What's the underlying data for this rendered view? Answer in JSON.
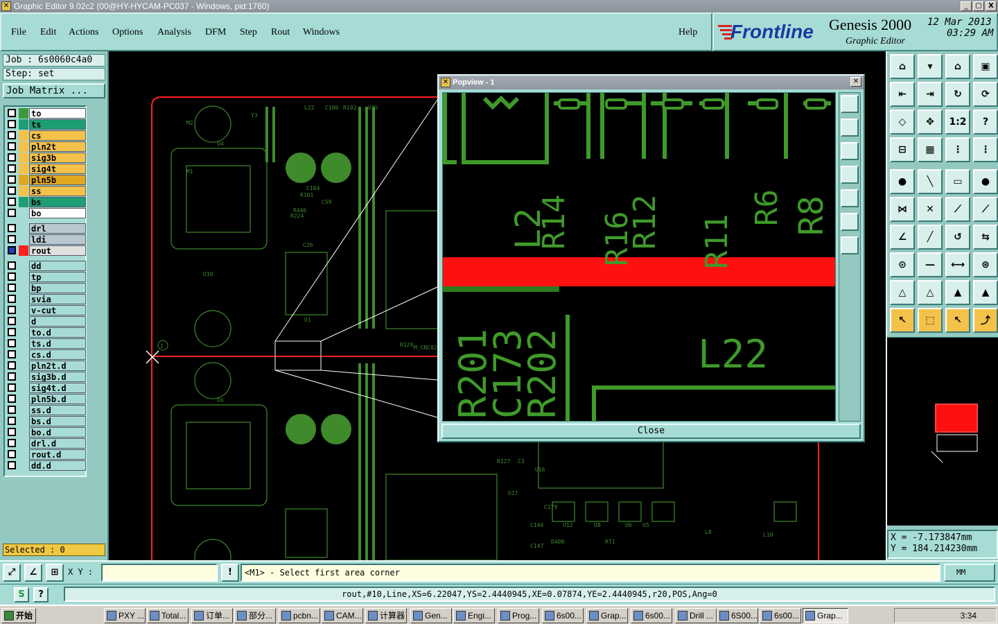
{
  "window": {
    "title": "Graphic Editor 9.02c2 (00@HY-HYCAM-PC037 - Windows, pid:1760)",
    "controls": [
      "_",
      "▢",
      "X"
    ]
  },
  "menubar": {
    "items": [
      "File",
      "Edit",
      "Actions",
      "Options",
      "Analysis",
      "DFM",
      "Step",
      "Rout",
      "Windows"
    ],
    "help": "Help"
  },
  "brand": {
    "logo_text": "Frontline",
    "product": "Genesis 2000",
    "subtitle": "Graphic Editor",
    "date": "12 Mar 2013",
    "time": "03:29 AM"
  },
  "left_panel": {
    "job": "Job : 6s0060c4a0",
    "step": "Step: set",
    "job_matrix": "Job Matrix ...",
    "layers": [
      {
        "name": "to",
        "color": "#ffffff",
        "swatch": "#3a9a3a"
      },
      {
        "name": "ts",
        "color": "#1e9e74",
        "swatch": "#1e9e74"
      },
      {
        "name": "cs",
        "color": "#f4c24a",
        "swatch": "#f4c24a"
      },
      {
        "name": "pln2t",
        "color": "#f4c24a",
        "swatch": "#f4c24a"
      },
      {
        "name": "sig3b",
        "color": "#f4c24a",
        "swatch": "#f4c24a"
      },
      {
        "name": "sig4t",
        "color": "#f4c24a",
        "swatch": "#f4c24a"
      },
      {
        "name": "pln5b",
        "color": "#e0a820",
        "swatch": "#e0a820"
      },
      {
        "name": "ss",
        "color": "#f4c24a",
        "swatch": "#f4c24a"
      },
      {
        "name": "bs",
        "color": "#1e9e74",
        "swatch": "#1e9e74"
      },
      {
        "name": "bo",
        "color": "#ffffff",
        "swatch": "#a7dcd6"
      },
      {
        "name": "drl",
        "color": "#b8c8d0",
        "swatch": "#a7dcd6"
      },
      {
        "name": "ldi",
        "color": "#b8c8d0",
        "swatch": "#a7dcd6"
      },
      {
        "name": "rout",
        "color": "#e0e0e0",
        "swatch": "#ff2020",
        "active": true
      },
      {
        "name": "dd",
        "color": "#a7dcd6",
        "swatch": "#a7dcd6"
      },
      {
        "name": "tp",
        "color": "#a7dcd6",
        "swatch": "#a7dcd6"
      },
      {
        "name": "bp",
        "color": "#a7dcd6",
        "swatch": "#a7dcd6"
      },
      {
        "name": "svia",
        "color": "#a7dcd6",
        "swatch": "#a7dcd6"
      },
      {
        "name": "v-cut",
        "color": "#a7dcd6",
        "swatch": "#a7dcd6"
      },
      {
        "name": "d",
        "color": "#a7dcd6",
        "swatch": "#a7dcd6"
      },
      {
        "name": "to.d",
        "color": "#a7dcd6",
        "swatch": "#a7dcd6"
      },
      {
        "name": "ts.d",
        "color": "#a7dcd6",
        "swatch": "#a7dcd6"
      },
      {
        "name": "cs.d",
        "color": "#a7dcd6",
        "swatch": "#a7dcd6"
      },
      {
        "name": "pln2t.d",
        "color": "#a7dcd6",
        "swatch": "#a7dcd6"
      },
      {
        "name": "sig3b.d",
        "color": "#a7dcd6",
        "swatch": "#a7dcd6"
      },
      {
        "name": "sig4t.d",
        "color": "#a7dcd6",
        "swatch": "#a7dcd6"
      },
      {
        "name": "pln5b.d",
        "color": "#a7dcd6",
        "swatch": "#a7dcd6"
      },
      {
        "name": "ss.d",
        "color": "#a7dcd6",
        "swatch": "#a7dcd6"
      },
      {
        "name": "bs.d",
        "color": "#a7dcd6",
        "swatch": "#a7dcd6"
      },
      {
        "name": "bo.d",
        "color": "#a7dcd6",
        "swatch": "#a7dcd6"
      },
      {
        "name": "drl.d",
        "color": "#a7dcd6",
        "swatch": "#a7dcd6"
      },
      {
        "name": "rout.d",
        "color": "#a7dcd6",
        "swatch": "#a7dcd6"
      },
      {
        "name": "dd.d",
        "color": "#a7dcd6",
        "swatch": "#a7dcd6"
      }
    ],
    "selected": "Selected : 0"
  },
  "popview": {
    "title": "Popview - 1",
    "close_label": "Close",
    "labels": [
      "L2",
      "R14",
      "R16",
      "R12",
      "R11",
      "R6",
      "R8",
      "R201",
      "C173",
      "R202",
      "L22"
    ]
  },
  "pcb": {
    "labels": [
      "L22",
      "U15",
      "R192",
      "C180",
      "Y3",
      "U4",
      "M2",
      "M1",
      "C184",
      "C59",
      "R101",
      "R446",
      "R224",
      "U16",
      "U1",
      "C26",
      "U4",
      "M_CNC02",
      "1",
      "U16",
      "U17",
      "U12",
      "U8",
      "U6",
      "U5",
      "D400",
      "C179",
      "C144",
      "C147",
      "RT1",
      "L8",
      "L10",
      "R129",
      "R127",
      "C3"
    ]
  },
  "right_panel": {
    "coord_x": "X = -7.173847mm",
    "coord_y": "Y = 184.214230mm",
    "tool_icons": [
      "home-icon",
      "zoom-window-icon",
      "zoom-home-icon",
      "grid-icon",
      "zoom-in-icon",
      "zoom-out-icon",
      "redraw-icon",
      "step-icon",
      "fit-icon",
      "pan-icon",
      "ratio-1-2-icon",
      "help-icon",
      "ruler-icon",
      "grid-toggle-icon",
      "snap-icon",
      "snap-alt-icon",
      "pad-icon",
      "line-icon",
      "measure-icon",
      "circle-icon",
      "node-icon",
      "cross-icon",
      "connect-icon",
      "connect-alt-icon",
      "angle-icon",
      "slope-icon",
      "arc-icon",
      "flip-icon",
      "pad-select-icon",
      "minus-icon",
      "dimension-icon",
      "group-icon",
      "triangle-icon",
      "triangle-alt-icon",
      "triangle-pick-icon",
      "triangle-edit-icon",
      "pointer-icon",
      "pointer-box-icon",
      "pointer-alt-icon",
      "path-icon"
    ]
  },
  "command": {
    "xy_label": "X Y :",
    "xy_value": "",
    "info_icon": "!",
    "prompt": "<M1> - Select first area corner",
    "units": "MM"
  },
  "status": {
    "text": "rout,#10,Line,XS=6.22047,YS=2.4440945,XE=0.07874,YE=2.4440945,r20,POS,Ang=0"
  },
  "taskbar": {
    "start": "开始",
    "tasks": [
      "PXY ...",
      "Total...",
      "订单...",
      "部分...",
      "pcbn...",
      "CAM...",
      "计算器",
      "Gen...",
      "Engi...",
      "Prog...",
      "6s00...",
      "Grap...",
      "6s00...",
      "Drill ...",
      "6S00...",
      "6s00...",
      "Grap..."
    ],
    "clock": "3:34"
  }
}
